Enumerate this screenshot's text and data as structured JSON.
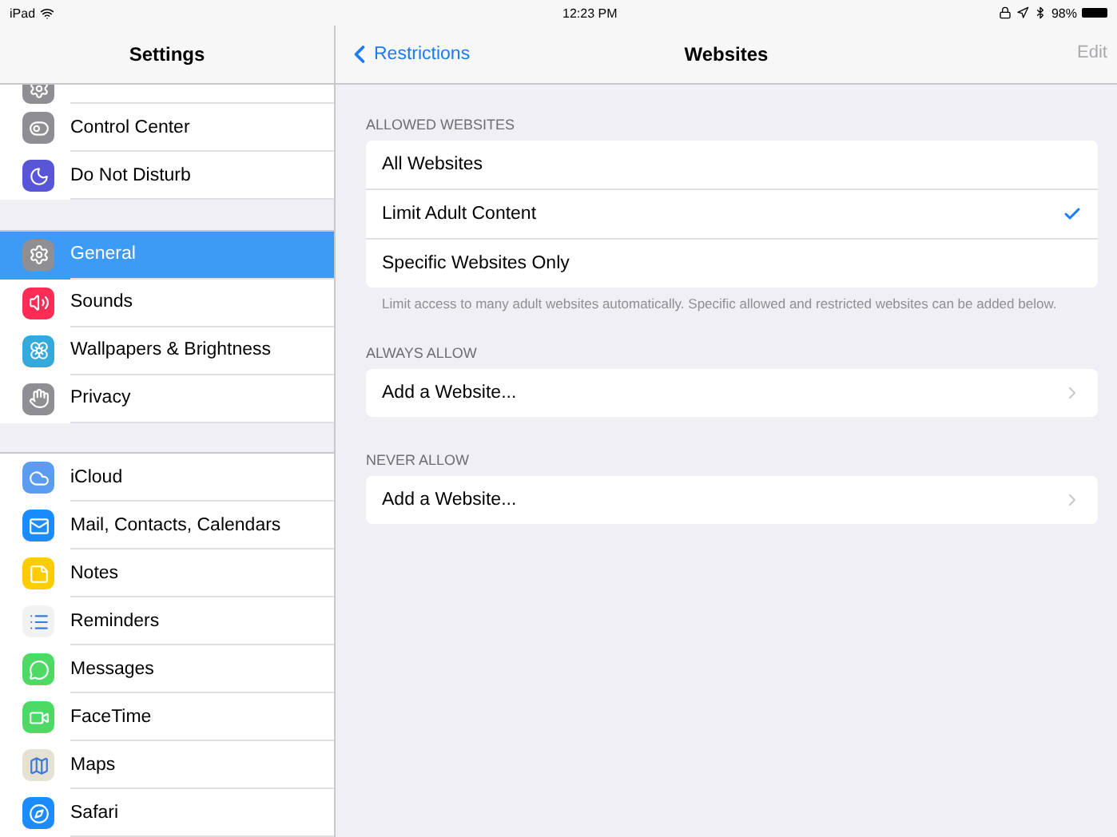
{
  "status_bar": {
    "device": "iPad",
    "time": "12:23 PM",
    "battery": "98%"
  },
  "sidebar": {
    "title": "Settings",
    "groups": [
      [
        {
          "selected": false,
          "color": "#8e8e93",
          "partial": true
        },
        {
          "label": "Control Center",
          "selected": false,
          "color": "#8e8e93"
        },
        {
          "label": "Do Not Disturb",
          "selected": false,
          "color": "#5856d6"
        }
      ],
      [
        {
          "label": "General",
          "selected": true,
          "color": "#8e8e93"
        },
        {
          "label": "Sounds",
          "selected": false,
          "color": "#ff2d55"
        },
        {
          "label": "Wallpapers & Brightness",
          "selected": false,
          "color": "#34aadc"
        },
        {
          "label": "Privacy",
          "selected": false,
          "color": "#8e8e93"
        }
      ],
      [
        {
          "label": "iCloud",
          "selected": false,
          "color": "#5b9cf0"
        },
        {
          "label": "Mail, Contacts, Calendars",
          "selected": false,
          "color": "#1a8cff"
        },
        {
          "label": "Notes",
          "selected": false,
          "color": "#ffcc00"
        },
        {
          "label": "Reminders",
          "selected": false,
          "color": "#f2f2f2"
        },
        {
          "label": "Messages",
          "selected": false,
          "color": "#4cd964"
        },
        {
          "label": "FaceTime",
          "selected": false,
          "color": "#4cd964"
        },
        {
          "label": "Maps",
          "selected": false,
          "color": "#e5e1d3"
        },
        {
          "label": "Safari",
          "selected": false,
          "color": "#1a8cff"
        }
      ]
    ]
  },
  "detail": {
    "back": "Restrictions",
    "title": "Websites",
    "edit": {
      "label": "Edit",
      "disabled": true
    },
    "sections": [
      {
        "header": "ALLOWED WEBSITES",
        "rows": [
          {
            "label": "All Websites",
            "checked": false,
            "kind": "check"
          },
          {
            "label": "Limit Adult Content",
            "checked": true,
            "kind": "check"
          },
          {
            "label": "Specific Websites Only",
            "checked": false,
            "kind": "check"
          }
        ],
        "footer": "Limit access to many adult websites automatically. Specific allowed and restricted websites can be added below."
      },
      {
        "header": "ALWAYS ALLOW",
        "rows": [
          {
            "label": "Add a Website...",
            "kind": "link"
          }
        ]
      },
      {
        "header": "NEVER ALLOW",
        "rows": [
          {
            "label": "Add a Website...",
            "kind": "link"
          }
        ]
      }
    ]
  }
}
